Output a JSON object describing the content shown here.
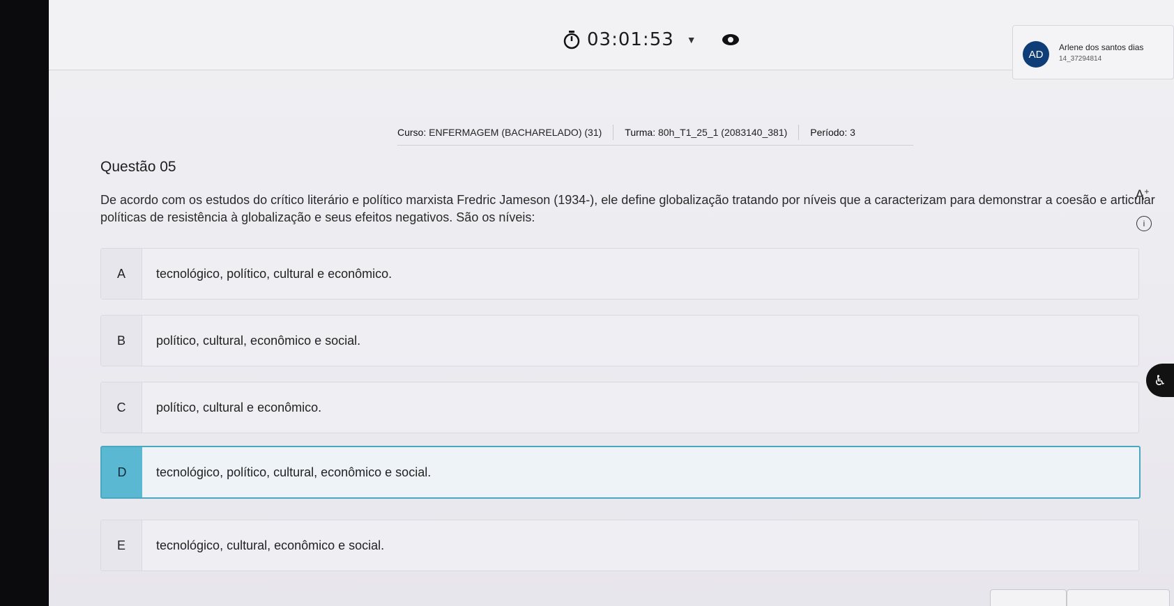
{
  "header": {
    "timer": "03:01:53",
    "user_initials": "AD",
    "user_name": "Arlene dos santos dias",
    "user_id": "14_37294814"
  },
  "course": {
    "curso_label": "Curso:",
    "curso_value": "ENFERMAGEM (BACHARELADO) (31)",
    "turma_label": "Turma:",
    "turma_value": "80h_T1_25_1 (2083140_381)",
    "periodo_label": "Período:",
    "periodo_value": "3"
  },
  "question": {
    "title": "Questão 05",
    "text": "De acordo com os estudos do crítico literário e político marxista Fredric Jameson (1934-), ele define globalização tratando por níveis que a caracterizam para demonstrar a coesão e articular políticas de resistência à globalização e seus efeitos negativos. São os níveis:"
  },
  "tools": {
    "font_size": "A",
    "font_size_sup": "+",
    "info": "i"
  },
  "options": [
    {
      "letter": "A",
      "text": "tecnológico, político, cultural e econômico."
    },
    {
      "letter": "B",
      "text": "político, cultural, econômico e social."
    },
    {
      "letter": "C",
      "text": "político, cultural e econômico."
    },
    {
      "letter": "D",
      "text": "tecnológico, político, cultural, econômico e social."
    },
    {
      "letter": "E",
      "text": "tecnológico, cultural, econômico e social."
    }
  ],
  "selected_option": "D",
  "colors": {
    "selected_accent": "#5bb8d2",
    "avatar_bg": "#0f3d78"
  }
}
